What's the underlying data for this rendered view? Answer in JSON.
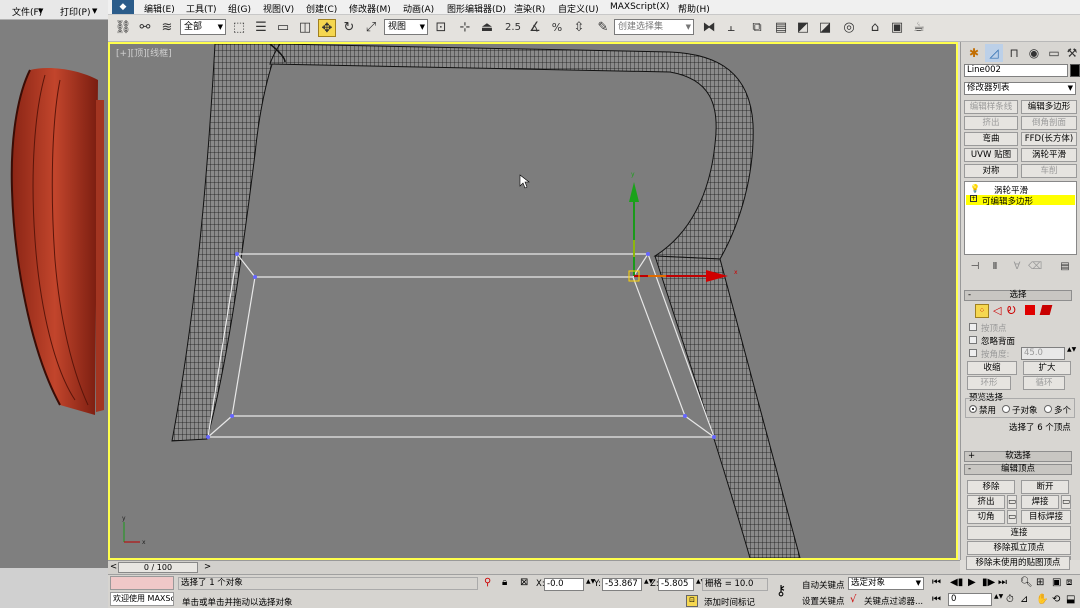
{
  "left_app": {
    "menu": [
      "文件(F)",
      "打印(P)"
    ]
  },
  "menubar": {
    "items": [
      "编辑(E)",
      "工具(T)",
      "组(G)",
      "视图(V)",
      "创建(C)",
      "修改器(M)",
      "动画(A)",
      "图形编辑器(D)",
      "渲染(R)",
      "自定义(U)",
      "MAXScript(X)",
      "帮助(H)"
    ]
  },
  "toolbar": {
    "filter_value": "全部",
    "refcoord_value": "视图",
    "named_selection_placeholder": "创建选择集"
  },
  "viewport": {
    "label": "[+][顶][线框]"
  },
  "command_panel": {
    "object_name": "Line002",
    "modifier_list": "修改器列表",
    "buttons": [
      {
        "label": "编辑样条线",
        "enabled": false
      },
      {
        "label": "编辑多边形",
        "enabled": true
      },
      {
        "label": "挤出",
        "enabled": false
      },
      {
        "label": "倒角剖面",
        "enabled": false
      },
      {
        "label": "弯曲",
        "enabled": true
      },
      {
        "label": "FFD(长方体)",
        "enabled": true
      },
      {
        "label": "UVW 贴图",
        "enabled": true
      },
      {
        "label": "涡轮平滑",
        "enabled": true
      },
      {
        "label": "对称",
        "enabled": true
      },
      {
        "label": "车削",
        "enabled": false
      }
    ],
    "stack": [
      {
        "label": "涡轮平滑",
        "selected": false
      },
      {
        "label": "可编辑多边形",
        "selected": true
      }
    ],
    "selection": {
      "title": "选择",
      "by_vertex": "按顶点",
      "ignore_backfacing": "忽略背面",
      "by_angle": "按角度:",
      "angle_value": "45.0",
      "shrink": "收缩",
      "grow": "扩大",
      "ring": "环形",
      "loop": "循环",
      "preview_title": "预览选择",
      "preview_options": [
        "禁用",
        "子对象",
        "多个"
      ],
      "status": "选择了 6 个顶点"
    },
    "soft_selection": "软选择",
    "edit_vertices": {
      "title": "编辑顶点",
      "remove": "移除",
      "break": "断开",
      "extrude": "挤出",
      "weld": "焊接",
      "chamfer": "切角",
      "target_weld": "目标焊接",
      "connect": "连接",
      "remove_isolated": "移除孤立顶点",
      "remove_unused_map": "移除未使用的贴图顶点"
    }
  },
  "timeline": {
    "frame": "0 / 100"
  },
  "status": {
    "welcome": "欢迎使用 MAXScr",
    "selected": "选择了 1 个对象",
    "prompt": "单击或单击并拖动以选择对象",
    "x_value": "-0.0",
    "y_value": "-53.867",
    "z_value": "-5.805",
    "grid": "栅格 = 10.0",
    "add_time_tag": "添加时间标记",
    "auto_key": "自动关键点",
    "set_key": "设置关键点",
    "selected_object": "选定对象",
    "key_filters": "关键点过滤器...",
    "frame_value": "0"
  },
  "colors": {
    "viewport_border": "#ffff4d",
    "selected_modifier": "#ffff00",
    "vertex_selected": "#6666ff"
  }
}
